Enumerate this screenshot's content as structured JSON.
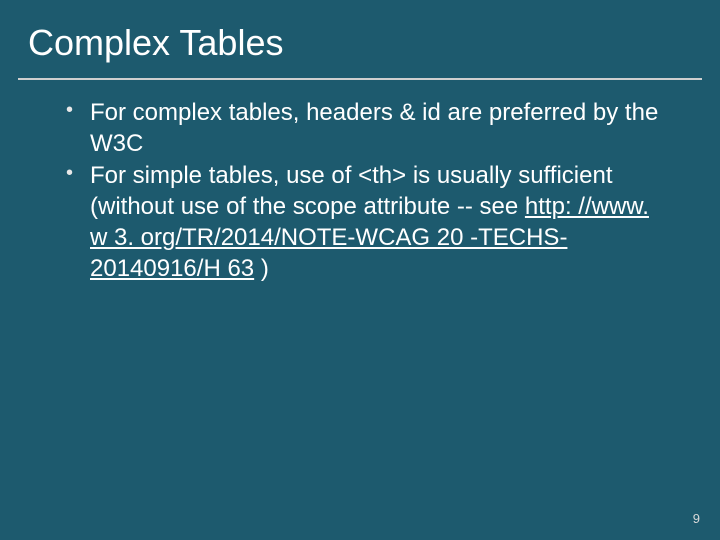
{
  "title": "Complex Tables",
  "bullets": [
    {
      "text_pre": "For complex tables, headers & id are preferred by the W3C",
      "link": "",
      "text_post": ""
    },
    {
      "text_pre": "For simple tables, use of <th> is usually sufficient (without use of the scope attribute -- see ",
      "link": "http: //www. w 3. org/TR/2014/NOTE-WCAG 20 -TECHS-20140916/H 63",
      "text_post": " )"
    }
  ],
  "page_number": "9"
}
